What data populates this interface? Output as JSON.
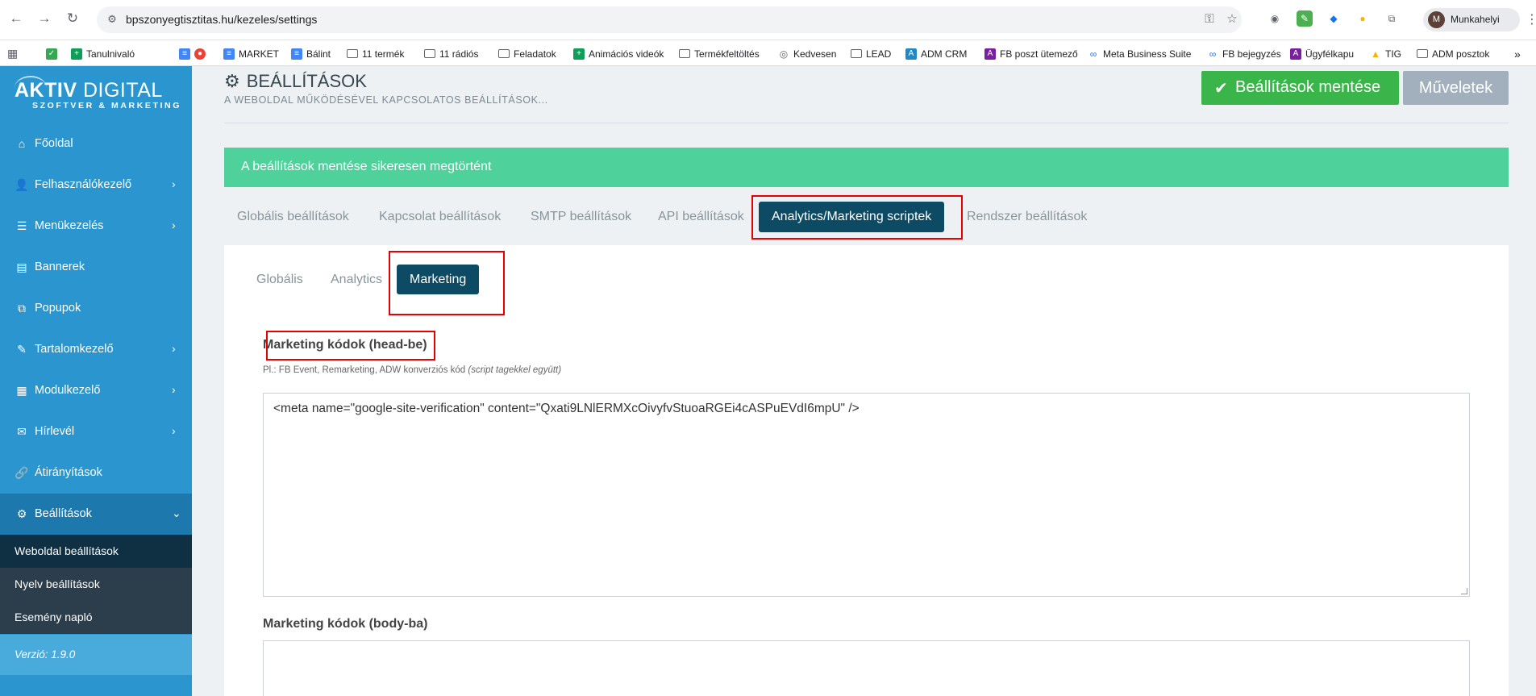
{
  "browser": {
    "url": "bpszonyegtisztitas.hu/kezeles/settings",
    "profile_initial": "M",
    "profile_name": "Munkahelyi",
    "bookmarks": [
      "Tanulnivaló",
      "MARKET",
      "Bálint",
      "11 termék",
      "11 rádiós",
      "Feladatok",
      "Animációs videók",
      "Termékfeltöltés",
      "Kedvesen",
      "LEAD",
      "ADM CRM",
      "FB poszt ütemező",
      "Meta Business Suite",
      "FB bejegyzés",
      "Ügyfélkapu",
      "TIG",
      "ADM posztok"
    ]
  },
  "sidebar": {
    "logo_line1_bold": "AKTIV",
    "logo_line1_rest": " DIGITAL",
    "logo_line2": "SZOFTVER & MARKETING",
    "items": [
      {
        "label": "Főoldal",
        "icon": "home-icon"
      },
      {
        "label": "Felhasználókezelő",
        "icon": "users-icon"
      },
      {
        "label": "Menükezelés",
        "icon": "list-icon"
      },
      {
        "label": "Bannerek",
        "icon": "banner-icon"
      },
      {
        "label": "Popupok",
        "icon": "popup-icon"
      },
      {
        "label": "Tartalomkezelő",
        "icon": "feather-icon"
      },
      {
        "label": "Modulkezelő",
        "icon": "grid-icon"
      },
      {
        "label": "Hírlevél",
        "icon": "envelope-icon"
      },
      {
        "label": "Átirányítások",
        "icon": "link-icon"
      },
      {
        "label": "Beállítások",
        "icon": "cogs-icon"
      }
    ],
    "subitems": [
      "Weboldal beállítások",
      "Nyelv beállítások",
      "Esemény napló"
    ],
    "version": "Verzió: 1.9.0"
  },
  "header": {
    "title": "BEÁLLÍTÁSOK",
    "subtitle": "A WEBOLDAL MŰKÖDÉSÉVEL KAPCSOLATOS BEÁLLÍTÁSOK...",
    "save_label": "Beállítások mentése",
    "ops_label": "Műveletek"
  },
  "alert": "A beállítások mentése sikeresen megtörtént",
  "tabs": [
    "Globális beállítások",
    "Kapcsolat beállítások",
    "SMTP beállítások",
    "API beállítások",
    "Analytics/Marketing scriptek",
    "Rendszer beállítások"
  ],
  "subtabs": [
    "Globális",
    "Analytics",
    "Marketing"
  ],
  "form": {
    "head_label": "Marketing kódok (head-be)",
    "head_hint": "Pl.: FB Event, Remarketing, ADW konverziós kód ",
    "head_hint_italic": "(script tagekkel együtt)",
    "head_value": "<meta name=\"google-site-verification\" content=\"Qxati9LNlERMXcOivyfvStuoaRGEi4cASPuEVdI6mpU\" />",
    "body_label": "Marketing kódok (body-ba)",
    "body_value": ""
  },
  "colors": {
    "sidebar": "#2a95cf",
    "active_tab": "#0d4a64",
    "save_button": "#39b54a",
    "alert": "#4ed19b",
    "highlight": "#e60000"
  }
}
